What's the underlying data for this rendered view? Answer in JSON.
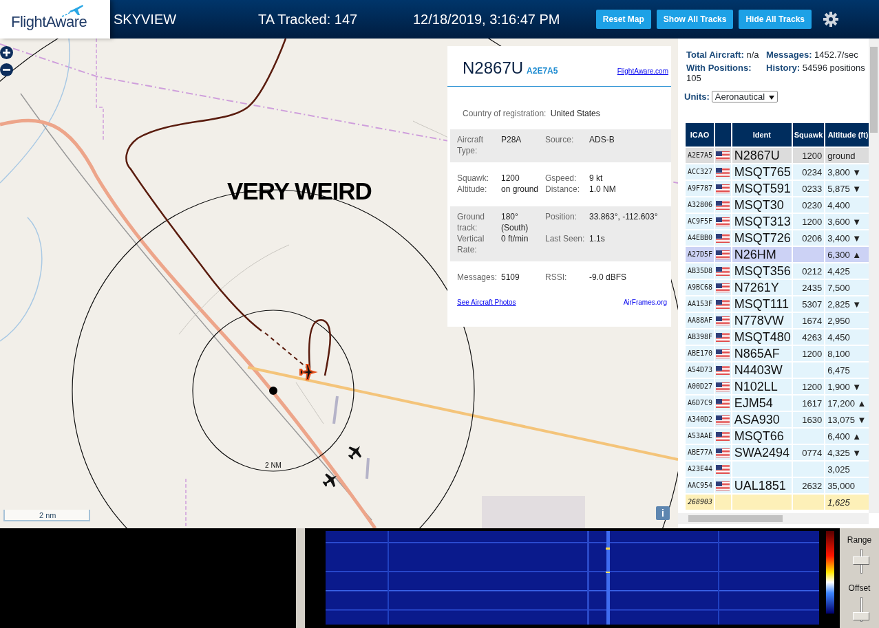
{
  "header": {
    "logo": "FlightAware",
    "title": "SKYVIEW",
    "tracked": "TA Tracked: 147",
    "datetime": "12/18/2019, 3:16:47 PM",
    "buttons": [
      "Reset Map",
      "Show All Tracks",
      "Hide All Tracks"
    ]
  },
  "map": {
    "annotation": "VERY WEIRD",
    "range_label": "2 NM",
    "scale_label": "2 nm",
    "info_button": "i"
  },
  "popup": {
    "callsign": "N2867U",
    "hex": "A2E7A5",
    "link": "FlightAware.com",
    "country_label": "Country of registration:",
    "country": "United States",
    "sections": [
      {
        "shaded": true,
        "rows": [
          [
            "Aircraft Type:",
            "P28A",
            "Source:",
            "ADS-B"
          ]
        ]
      },
      {
        "shaded": false,
        "rows": [
          [
            "Squawk:",
            "1200",
            "Gspeed:",
            "9 kt"
          ],
          [
            "Altitude:",
            "on ground",
            "Distance:",
            "1.0 NM"
          ]
        ]
      },
      {
        "shaded": true,
        "rows": [
          [
            "Ground track:",
            "180° (South)",
            "Position:",
            "33.863°, -112.603°"
          ],
          [
            "Vertical Rate:",
            "0 ft/min",
            "Last Seen:",
            "1.1s"
          ]
        ]
      },
      {
        "shaded": false,
        "rows": [
          [
            "Messages:",
            "5109",
            "RSSI:",
            "-9.0 dBFS"
          ]
        ]
      }
    ],
    "photos_link": "See Aircraft Photos",
    "airframes_link": "AirFrames.org"
  },
  "stats": [
    {
      "label": "Total Aircraft:",
      "value": "n/a"
    },
    {
      "label": "Messages:",
      "value": "1452.7/sec"
    },
    {
      "label": "With Positions:",
      "value": "105"
    },
    {
      "label": "History:",
      "value": "54596 positions"
    }
  ],
  "units": {
    "label": "Units:",
    "value": "Aeronautical"
  },
  "table": {
    "columns": [
      "ICAO",
      "Ident",
      "Squawk",
      "Altitude (ft)"
    ],
    "rows": [
      {
        "icao": "A2E7A5",
        "flag": true,
        "ident": "N2867U",
        "squawk": "1200",
        "altitude": "ground",
        "selected": true,
        "highlighted": false
      },
      {
        "icao": "ACC327",
        "flag": true,
        "ident": "MSQT765",
        "squawk": "0234",
        "altitude": "3,800 ▼",
        "selected": false,
        "highlighted": false
      },
      {
        "icao": "A9F787",
        "flag": true,
        "ident": "MSQT591",
        "squawk": "0233",
        "altitude": "5,875 ▼",
        "selected": false,
        "highlighted": false
      },
      {
        "icao": "A32806",
        "flag": true,
        "ident": "MSQT30",
        "squawk": "0230",
        "altitude": "4,400",
        "selected": false,
        "highlighted": false
      },
      {
        "icao": "AC9F5F",
        "flag": true,
        "ident": "MSQT313",
        "squawk": "1200",
        "altitude": "3,600 ▼",
        "selected": false,
        "highlighted": false
      },
      {
        "icao": "A4EBB0",
        "flag": true,
        "ident": "MSQT726",
        "squawk": "0206",
        "altitude": "3,400 ▼",
        "selected": false,
        "highlighted": false
      },
      {
        "icao": "A27D5F",
        "flag": true,
        "ident": "N26HM",
        "altitude": "6,300 ▲",
        "selected": false,
        "highlighted": true
      },
      {
        "icao": "AB35D8",
        "flag": true,
        "ident": "MSQT356",
        "squawk": "0212",
        "altitude": "4,425",
        "selected": false,
        "highlighted": false
      },
      {
        "icao": "A9BC68",
        "flag": true,
        "ident": "N7261Y",
        "squawk": "2435",
        "altitude": "7,500",
        "selected": false,
        "highlighted": false
      },
      {
        "icao": "AA153F",
        "flag": true,
        "ident": "MSQT111",
        "squawk": "5307",
        "altitude": "2,825 ▼",
        "selected": false,
        "highlighted": false
      },
      {
        "icao": "AA88AF",
        "flag": true,
        "ident": "N778VW",
        "squawk": "1674",
        "altitude": "2,950",
        "selected": false,
        "highlighted": false
      },
      {
        "icao": "AB398F",
        "flag": true,
        "ident": "MSQT480",
        "squawk": "4263",
        "altitude": "4,450",
        "selected": false,
        "highlighted": false
      },
      {
        "icao": "ABE170",
        "flag": true,
        "ident": "N865AF",
        "squawk": "1200",
        "altitude": "8,100",
        "selected": false,
        "highlighted": false
      },
      {
        "icao": "A54D73",
        "flag": true,
        "ident": "N4403W",
        "altitude": "6,475",
        "selected": false,
        "highlighted": false
      },
      {
        "icao": "A00D27",
        "flag": true,
        "ident": "N102LL",
        "squawk": "1200",
        "altitude": "1,900 ▼",
        "selected": false,
        "highlighted": false
      },
      {
        "icao": "A6D7C9",
        "flag": true,
        "ident": "EJM54",
        "squawk": "1617",
        "altitude": "17,200 ▲",
        "selected": false,
        "highlighted": false
      },
      {
        "icao": "A340D2",
        "flag": true,
        "ident": "ASA930",
        "squawk": "1630",
        "altitude": "13,075 ▼",
        "selected": false,
        "highlighted": false
      },
      {
        "icao": "A53AAE",
        "flag": true,
        "ident": "MSQT66",
        "altitude": "6,400 ▲",
        "selected": false,
        "highlighted": false
      },
      {
        "icao": "ABE77A",
        "flag": true,
        "ident": "SWA2494",
        "squawk": "0774",
        "altitude": "4,325 ▼",
        "selected": false,
        "highlighted": false
      },
      {
        "icao": "A23E44",
        "flag": true,
        "altitude": "3,025",
        "selected": false,
        "highlighted": false
      },
      {
        "icao": "AAC954",
        "flag": true,
        "ident": "UAL1851",
        "squawk": "2632",
        "altitude": "35,000",
        "selected": false,
        "highlighted": false
      },
      {
        "icao": "268903",
        "flag": false,
        "altitude": "1,625",
        "selected": false,
        "highlighted": false,
        "kind": "other"
      }
    ]
  },
  "spectrum": {
    "range_label": "Range",
    "offset_label": "Offset"
  }
}
